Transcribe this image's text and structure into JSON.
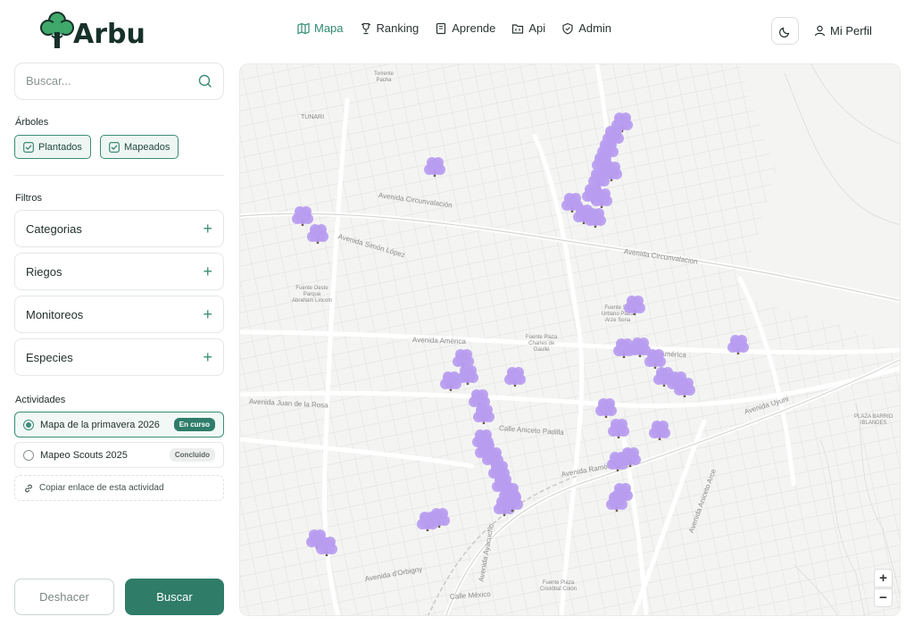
{
  "header": {
    "brand": "Arbu",
    "nav": [
      {
        "label": "Mapa",
        "icon": "map-icon",
        "active": true
      },
      {
        "label": "Ranking",
        "icon": "trophy-icon",
        "active": false
      },
      {
        "label": "Aprende",
        "icon": "book-icon",
        "active": false
      },
      {
        "label": "Api",
        "icon": "code-folder-icon",
        "active": false
      },
      {
        "label": "Admin",
        "icon": "shield-icon",
        "active": false
      }
    ],
    "theme_icon": "moon-icon",
    "profile_label": "Mi Perfil",
    "profile_icon": "user-icon"
  },
  "sidebar": {
    "search_placeholder": "Buscar...",
    "trees_heading": "Árboles",
    "tree_chips": [
      {
        "label": "Plantados",
        "checked": true
      },
      {
        "label": "Mapeados",
        "checked": true
      }
    ],
    "filters_heading": "Filtros",
    "filters": [
      "Categorias",
      "Riegos",
      "Monitoreos",
      "Especies"
    ],
    "activities_heading": "Actividades",
    "activities": [
      {
        "label": "Mapa de la primavera 2026",
        "status": "En curso",
        "selected": true
      },
      {
        "label": "Mapeo Scouts 2025",
        "status": "Concluido",
        "selected": false
      }
    ],
    "copy_link_label": "Copiar enlace de esta actividad",
    "undo_label": "Deshacer",
    "search_button_label": "Buscar"
  },
  "map": {
    "streets": [
      {
        "text": "Avenida Circunvalación"
      },
      {
        "text": "Avenida Simón López"
      },
      {
        "text": "Avenida América"
      },
      {
        "text": "Avenida América"
      },
      {
        "text": "Avenida Circunvalacion"
      },
      {
        "text": "Avenida Juan de la Rosa"
      },
      {
        "text": "Calle Aniceto Padilla"
      },
      {
        "text": "Avenida Ramón Rivero"
      },
      {
        "text": "Avenida Uyuni"
      },
      {
        "text": "Avenida Aniceto Arce"
      },
      {
        "text": "Calle México"
      },
      {
        "text": "Avenida Ayacucho"
      },
      {
        "text": "Avenida d'Orbigny"
      }
    ],
    "places": [
      {
        "text": "Torrente\nPacha"
      },
      {
        "text": "TUNARI"
      },
      {
        "text": "Fuente Oeste\nParque\nAbraham Lincoln"
      },
      {
        "text": "Fuente Plaza\nCharles de\nGaulle"
      },
      {
        "text": "Fuente Sur\nUrbano Plaza\nArze Soria"
      },
      {
        "text": "PLAZA BARRIO\nIBLANDES"
      },
      {
        "text": "Fuente Plaza\nCristóbal Colón"
      }
    ],
    "zoom_in": "+",
    "zoom_out": "−",
    "tree_icon": "jacaranda-tree-icon",
    "colors": {
      "tree": "#b79cf0",
      "trunk": "#6b5a48",
      "accent": "#2f7c68"
    }
  }
}
